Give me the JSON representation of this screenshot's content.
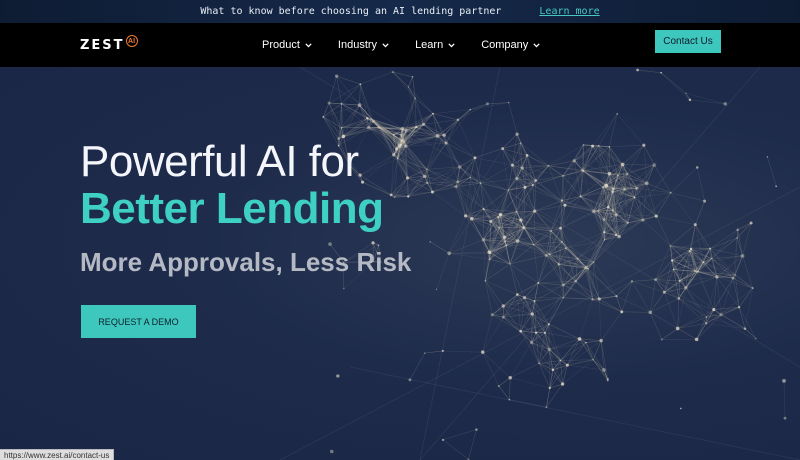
{
  "announcement": {
    "text": "What to know before choosing an AI lending partner",
    "link_label": "Learn more"
  },
  "nav": {
    "logo_text": "ZEST",
    "logo_badge": "AI",
    "menu": [
      {
        "label": "Product",
        "icon": "chevron-down-icon"
      },
      {
        "label": "Industry",
        "icon": "chevron-down-icon"
      },
      {
        "label": "Learn",
        "icon": "chevron-down-icon"
      },
      {
        "label": "Company",
        "icon": "chevron-down-icon"
      }
    ],
    "contact_label": "Contact Us"
  },
  "hero": {
    "line1": "Powerful AI for",
    "line2": "Better Lending",
    "subtitle": "More Approvals, Less Risk",
    "cta_label": "REQUEST A DEMO"
  },
  "status_bar": {
    "url": "https://www.zest.ai/contact-us"
  },
  "colors": {
    "accent": "#3ec7bd",
    "hero_bg": "#1e2b4b",
    "nav_bg": "#000000",
    "logo_orange": "#f07a2c"
  }
}
